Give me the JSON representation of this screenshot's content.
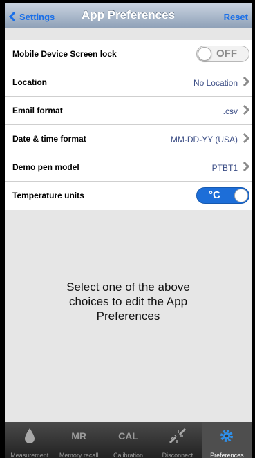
{
  "navbar": {
    "back_label": "Settings",
    "title": "App Preferences",
    "reset_label": "Reset"
  },
  "rows": [
    {
      "label": "Mobile Device Screen lock",
      "control": "toggle",
      "toggle_text": "OFF",
      "on": false
    },
    {
      "label": "Location",
      "value": "No Location",
      "control": "disclosure"
    },
    {
      "label": "Email format",
      "value": ".csv",
      "control": "disclosure"
    },
    {
      "label": "Date & time format",
      "value": "MM-DD-YY (USA)",
      "control": "disclosure"
    },
    {
      "label": "Demo pen model",
      "value": "PTBT1",
      "control": "disclosure"
    },
    {
      "label": "Temperature units",
      "control": "toggle",
      "toggle_text": "°C",
      "on": true
    }
  ],
  "message": "Select one of the above choices to edit the App Preferences",
  "tabs": [
    {
      "label": "Measurement",
      "icon": "drop-icon"
    },
    {
      "label": "Memory recall",
      "icon_text": "MR"
    },
    {
      "label": "Calibration",
      "icon_text": "CAL"
    },
    {
      "label": "Disconnect",
      "icon": "disconnect-icon"
    },
    {
      "label": "Preferences",
      "icon": "gear-icon",
      "active": true
    }
  ],
  "colors": {
    "accent": "#1a6fe8",
    "toggle_on": "#1d6ed8",
    "tabbar": "#2a2a2a"
  }
}
